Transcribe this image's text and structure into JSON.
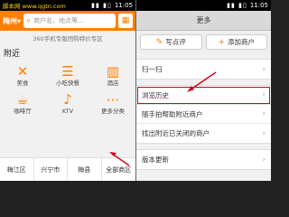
{
  "left": {
    "status": {
      "watermark": "脚本网 www.qgtn.com",
      "icons": "▮▮ ▮▯",
      "time": "11:05"
    },
    "city": "梅州",
    "search_placeholder": "商户名，地点等...",
    "banner": "360手机专版团购特价专区",
    "nearby_title": "附近",
    "categories": [
      "美食",
      "小吃快餐",
      "酒店",
      "咖啡厅",
      "KTV",
      "更多分类"
    ],
    "areas": [
      "梅江区",
      "兴宁市",
      "梅县",
      "全部商区"
    ]
  },
  "right": {
    "status": {
      "icons": "▮▮ ▮▯",
      "time": "11:05"
    },
    "title": "更多",
    "write_review": "写点评",
    "add_merchant": "添加商户",
    "menu1": [
      "扫一扫"
    ],
    "menu2": [
      "浏览历史",
      "随手拍帮助附近商户",
      "找出附近已关闭的商户"
    ],
    "menu3": [
      "版本更新"
    ]
  },
  "colors": {
    "brand": "#ff7f00",
    "highlight": "#d0021b"
  }
}
